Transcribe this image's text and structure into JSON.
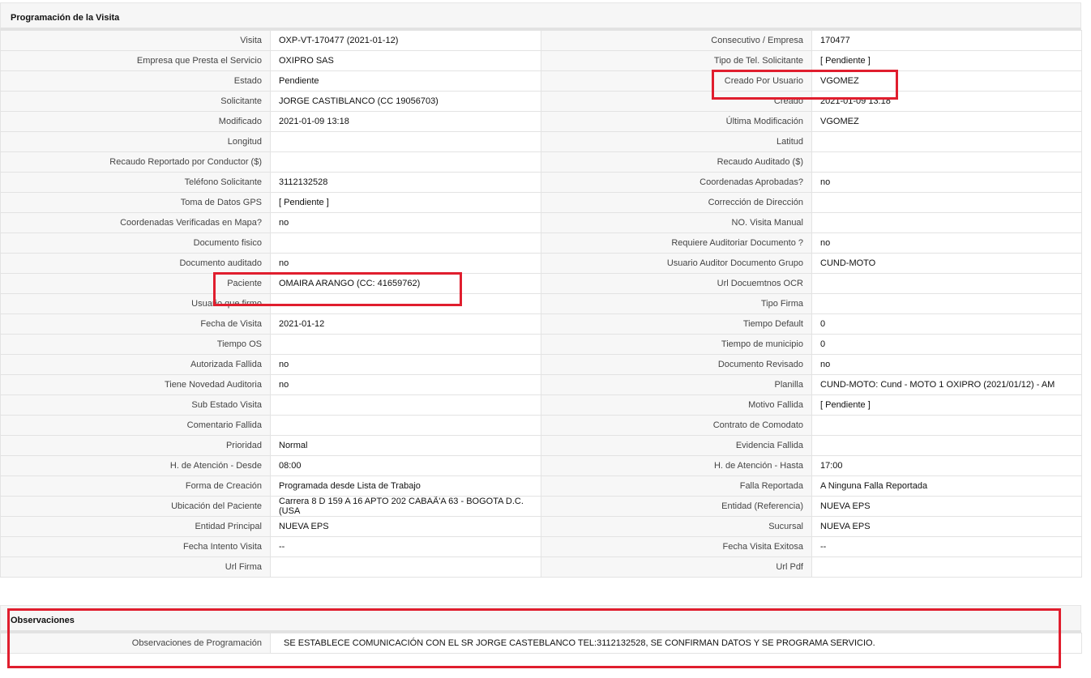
{
  "section_prog": {
    "title": "Programación de la Visita"
  },
  "rows": [
    {
      "l1": "Visita",
      "v1": "OXP-VT-170477 (2021-01-12)",
      "l2": "Consecutivo / Empresa",
      "v2": "170477"
    },
    {
      "l1": "Empresa que Presta el Servicio",
      "v1": "OXIPRO SAS",
      "l2": "Tipo de Tel. Solicitante",
      "v2": "[ Pendiente ]"
    },
    {
      "l1": "Estado",
      "v1": "Pendiente",
      "l2": "Creado Por Usuario",
      "v2": "VGOMEZ"
    },
    {
      "l1": "Solicitante",
      "v1": "JORGE CASTIBLANCO (CC 19056703)",
      "l2": "Creado",
      "v2": "2021-01-09 13:18"
    },
    {
      "l1": "Modificado",
      "v1": "2021-01-09 13:18",
      "l2": "Última Modificación",
      "v2": " VGOMEZ"
    },
    {
      "l1": "Longitud",
      "v1": "",
      "l2": "Latitud",
      "v2": ""
    },
    {
      "l1": "Recaudo Reportado por Conductor ($)",
      "v1": "",
      "l2": "Recaudo Auditado ($)",
      "v2": ""
    },
    {
      "l1": "Teléfono Solicitante",
      "v1": "3112132528",
      "l2": "Coordenadas Aprobadas?",
      "v2": " no"
    },
    {
      "l1": "Toma de Datos GPS",
      "v1": "[ Pendiente ]",
      "l2": "Corrección de Dirección",
      "v2": ""
    },
    {
      "l1": "Coordenadas Verificadas en Mapa?",
      "v1": " no",
      "l2": "NO. Visita Manual",
      "v2": ""
    },
    {
      "l1": "Documento fisico",
      "v1": "",
      "l2": "Requiere Auditoriar Documento ?",
      "v2": " no"
    },
    {
      "l1": "Documento auditado",
      "v1": " no",
      "l2": "Usuario Auditor Documento Grupo",
      "v2": "CUND-MOTO"
    },
    {
      "l1": "Paciente",
      "v1": "OMAIRA ARANGO (CC: 41659762)",
      "l2": "Url Docuemtnos OCR",
      "v2": ""
    },
    {
      "l1": "Usuario que firmo",
      "v1": "",
      "l2": "Tipo Firma",
      "v2": ""
    },
    {
      "l1": "Fecha de Visita",
      "v1": " 2021-01-12",
      "l2": "Tiempo Default",
      "v2": "0"
    },
    {
      "l1": "Tiempo OS",
      "v1": "",
      "l2": "Tiempo de municipio",
      "v2": "0"
    },
    {
      "l1": "Autorizada Fallida",
      "v1": " no",
      "l2": "Documento Revisado",
      "v2": " no"
    },
    {
      "l1": "Tiene Novedad Auditoria",
      "v1": " no",
      "l2": "Planilla",
      "v2": "CUND-MOTO: Cund - MOTO 1 OXIPRO (2021/01/12) - AM"
    },
    {
      "l1": "Sub Estado Visita",
      "v1": "",
      "l2": "Motivo Fallida",
      "v2": "[ Pendiente ]"
    },
    {
      "l1": "Comentario Fallida",
      "v1": "",
      "l2": "Contrato de Comodato",
      "v2": ""
    },
    {
      "l1": "Prioridad",
      "v1": "Normal",
      "l2": "Evidencia Fallida",
      "v2": ""
    },
    {
      "l1": "H. de Atención - Desde",
      "v1": "08:00",
      "l2": "H. de Atención - Hasta",
      "v2": "17:00"
    },
    {
      "l1": "Forma de Creación",
      "v1": "Programada desde Lista de Trabajo",
      "l2": "Falla Reportada",
      "v2": "A Ninguna Falla Reportada"
    },
    {
      "l1": "Ubicación del Paciente",
      "v1": "Carrera 8 D 159 A 16 APTO 202 CABAÃ'A 63 - BOGOTA D.C. (USA",
      "l2": "Entidad (Referencia)",
      "v2": "NUEVA EPS"
    },
    {
      "l1": "Entidad Principal",
      "v1": "NUEVA EPS",
      "l2": "Sucursal",
      "v2": "NUEVA EPS"
    },
    {
      "l1": "Fecha Intento Visita",
      "v1": " --",
      "l2": "Fecha Visita Exitosa",
      "v2": " --"
    },
    {
      "l1": "Url Firma",
      "v1": "",
      "l2": "Url Pdf",
      "v2": ""
    }
  ],
  "section_obs": {
    "title": "Observaciones",
    "label": "Observaciones de Programación",
    "value": "SE ESTABLECE COMUNICACIÓN CON EL SR JORGE CASTEBLANCO TEL:3112132528, SE CONFIRMAN DATOS Y SE PROGRAMA SERVICIO."
  },
  "colors": {
    "highlight": "#e01e2e",
    "label_bg": "#f7f7f7",
    "header_bg": "#f6f6f6",
    "border": "#e3e3e3"
  }
}
